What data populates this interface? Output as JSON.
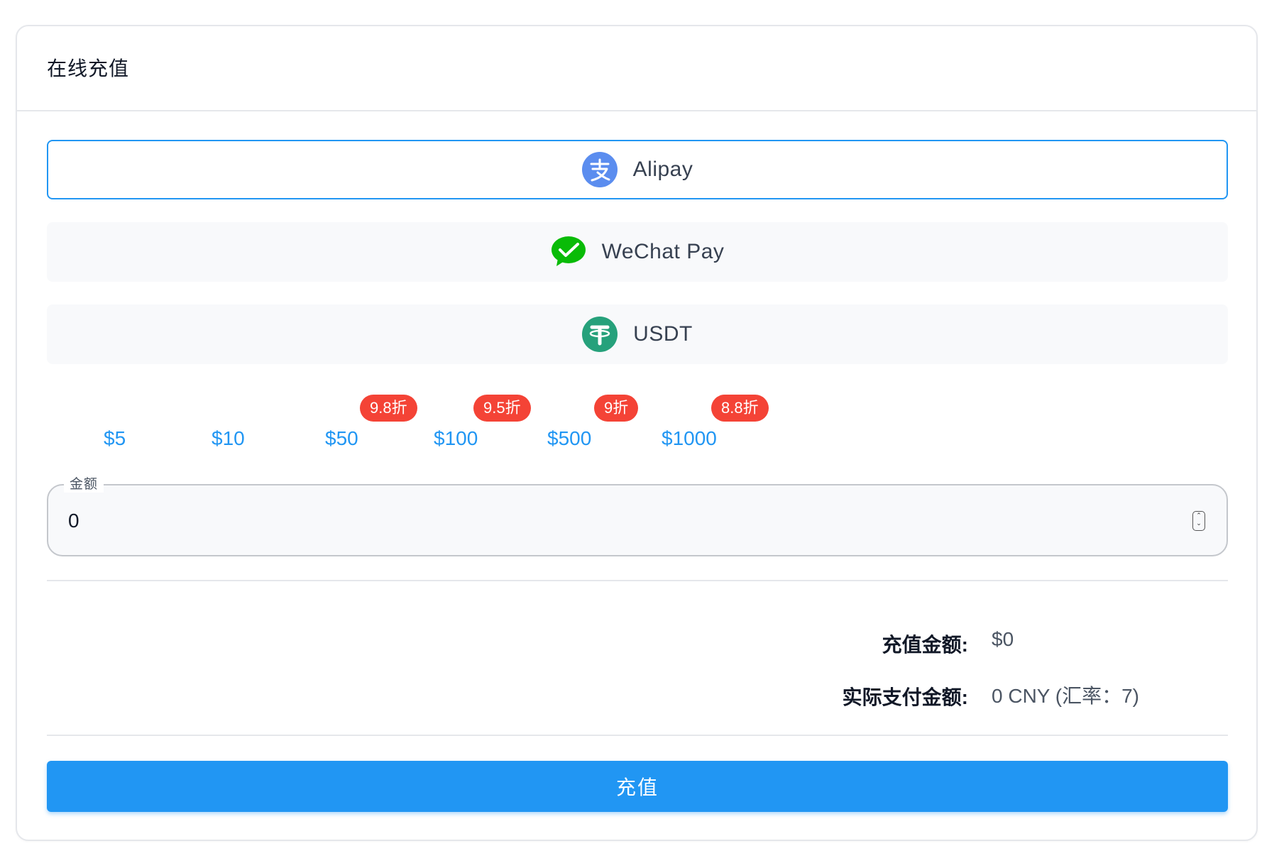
{
  "card": {
    "title": "在线充值"
  },
  "payment_methods": [
    {
      "label": "Alipay",
      "icon": "alipay-icon",
      "selected": true,
      "color": "#5b8def"
    },
    {
      "label": "WeChat Pay",
      "icon": "wechat-pay-icon",
      "selected": false,
      "color": "#09bb07"
    },
    {
      "label": "USDT",
      "icon": "usdt-icon",
      "selected": false,
      "color": "#26a17b"
    }
  ],
  "presets": [
    {
      "label": "$5",
      "badge": ""
    },
    {
      "label": "$10",
      "badge": ""
    },
    {
      "label": "$50",
      "badge": "9.8折"
    },
    {
      "label": "$100",
      "badge": "9.5折"
    },
    {
      "label": "$500",
      "badge": "9折"
    },
    {
      "label": "$1000",
      "badge": "8.8折"
    }
  ],
  "amount_field": {
    "legend": "金额",
    "value": "0"
  },
  "summary": {
    "recharge_label": "充值金额:",
    "recharge_value": "$0",
    "actual_label": "实际支付金额:",
    "actual_value": "0 CNY (汇率：7)"
  },
  "submit": {
    "label": "充值"
  },
  "colors": {
    "accent": "#2196f3",
    "badge": "#f44336",
    "option_bg": "#f8f9fb"
  }
}
